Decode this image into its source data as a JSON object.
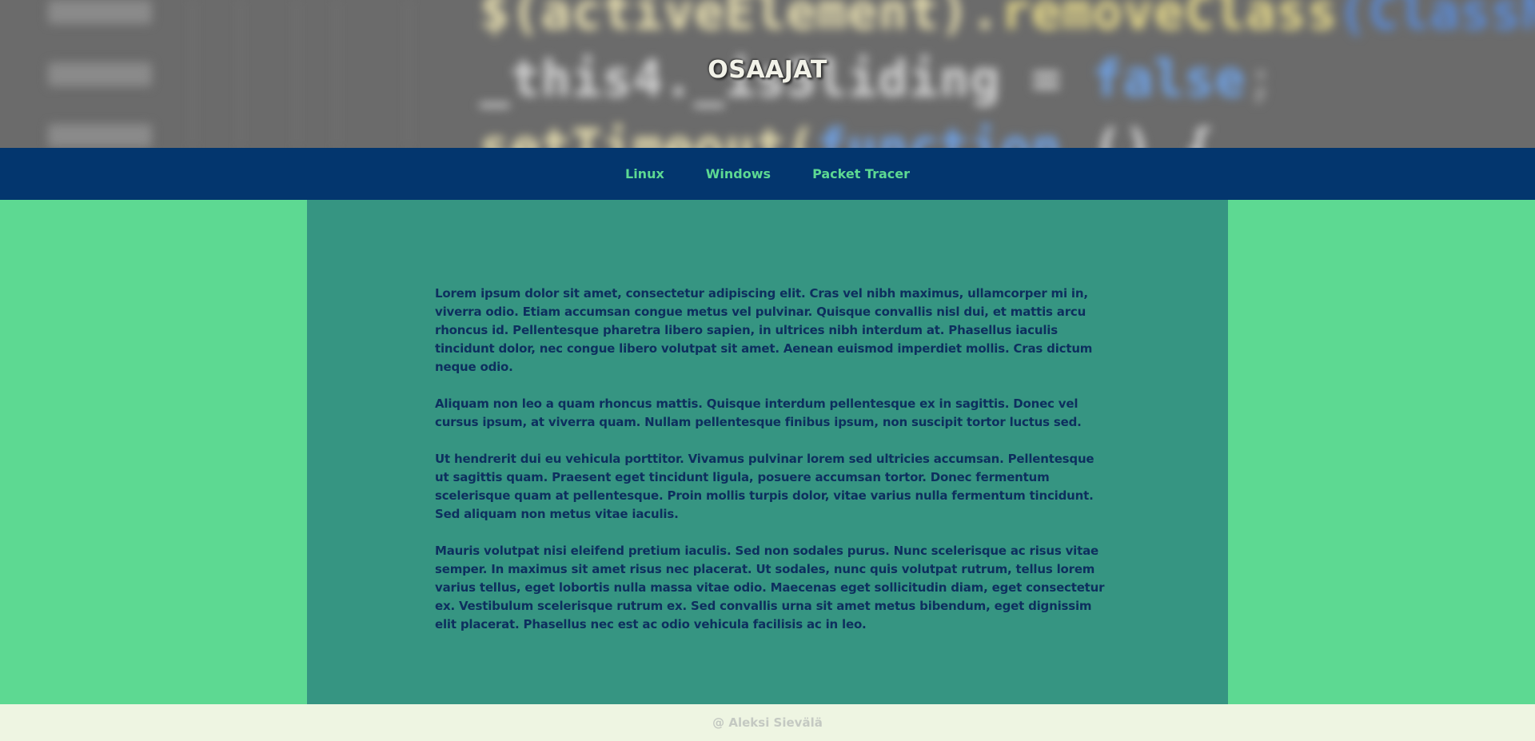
{
  "header": {
    "title": "OSAAJAT"
  },
  "nav": {
    "items": [
      {
        "label": "Linux"
      },
      {
        "label": "Windows"
      },
      {
        "label": "Packet Tracer"
      }
    ]
  },
  "main": {
    "paragraphs": [
      "Lorem ipsum dolor sit amet, consectetur adipiscing elit. Cras vel nibh maximus, ullamcorper mi in, viverra odio. Etiam accumsan congue metus vel pulvinar. Quisque convallis nisl dui, et mattis arcu rhoncus id. Pellentesque pharetra libero sapien, in ultrices nibh interdum at. Phasellus iaculis tincidunt dolor, nec congue libero volutpat sit amet. Aenean euismod imperdiet mollis. Cras dictum neque odio.",
      "Aliquam non leo a quam rhoncus mattis. Quisque interdum pellentesque ex in sagittis. Donec vel cursus ipsum, at viverra quam. Nullam pellentesque finibus ipsum, non suscipit tortor luctus sed.",
      "Ut hendrerit dui eu vehicula porttitor. Vivamus pulvinar lorem sed ultricies accumsan. Pellentesque ut sagittis quam. Praesent eget tincidunt ligula, posuere accumsan tortor. Donec fermentum scelerisque quam at pellentesque. Proin mollis turpis dolor, vitae varius nulla fermentum tincidunt. Sed aliquam non metus vitae iaculis.",
      "Mauris volutpat nisi eleifend pretium iaculis. Sed non sodales purus. Nunc scelerisque ac risus vitae semper. In maximus sit amet risus nec placerat. Ut sodales, nunc quis volutpat rutrum, tellus lorem varius tellus, eget lobortis nulla massa vitae odio. Maecenas eget sollicitudin diam, eget consectetur ex. Vestibulum scelerisque rutrum ex. Sed convallis urna sit amet metus bibendum, eget dignissim elit placerat. Phasellus nec est ac odio vehicula facilisis ac in leo."
    ]
  },
  "footer": {
    "text": "@ Aleksi Sievälä"
  },
  "colors": {
    "page_background": "#5dd992",
    "nav_background": "#03366e",
    "nav_link": "#5dd992",
    "content_background": "#369582",
    "content_text": "#0d2f5e",
    "footer_background": "#eef5e2",
    "footer_text": "#c4c9c2"
  }
}
